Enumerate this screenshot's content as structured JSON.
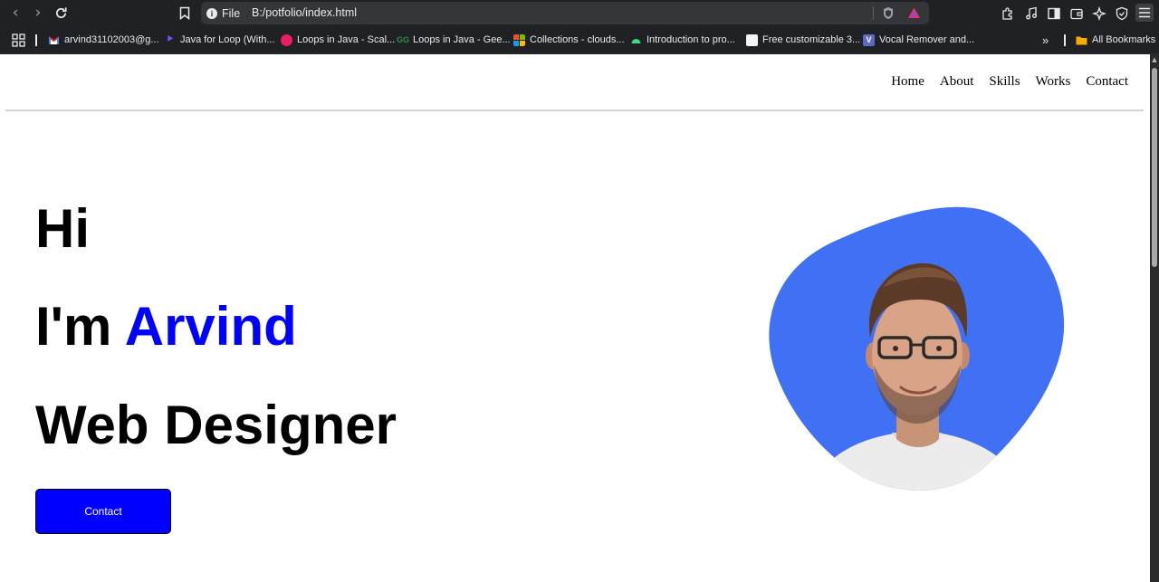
{
  "browser": {
    "site_info_label": "File",
    "url": "B:/potfolio/index.html",
    "bookmarks": [
      {
        "label": "arvind31102003@g...",
        "color": "#d93025"
      },
      {
        "label": "Java for Loop (With...",
        "color": "#7c4dff"
      },
      {
        "label": "Loops in Java - Scal...",
        "color": "#e91e63"
      },
      {
        "label": "Loops in Java - Gee...",
        "color": "#2f8d46"
      },
      {
        "label": "Collections - clouds...",
        "color": "#f25022"
      },
      {
        "label": "Introduction to pro...",
        "color": "#3ddc84"
      },
      {
        "label": "Free customizable 3...",
        "color": "#f1f3f4"
      },
      {
        "label": "Vocal Remover and...",
        "color": "#5c6bc0"
      }
    ],
    "all_bookmarks_label": "All Bookmarks"
  },
  "nav": {
    "links": [
      "Home",
      "About",
      "Skills",
      "Works",
      "Contact"
    ]
  },
  "hero": {
    "greeting": "Hi",
    "intro_prefix": "I'm ",
    "name": "Arvind",
    "role": "Web Designer",
    "button_label": "Contact",
    "accent_color": "#0000ff",
    "blob_color": "#4070f4"
  }
}
